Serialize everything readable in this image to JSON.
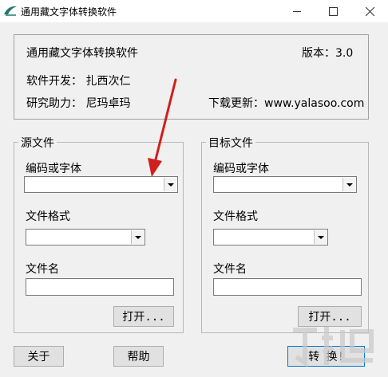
{
  "window": {
    "title": "通用藏文字体转换软件"
  },
  "info": {
    "app_name": "通用藏文字体转换软件",
    "version": "版本：3.0",
    "developer": "软件开发： 扎西次仁",
    "assistant": "研究助力： 尼玛卓玛",
    "download": "下载更新：www.yalasoo.com"
  },
  "source": {
    "group_label": "源文件",
    "encoding_label": "编码或字体",
    "encoding_value": "",
    "format_label": "文件格式",
    "format_value": "",
    "filename_label": "文件名",
    "filename_value": "",
    "open_button": "打开..."
  },
  "target": {
    "group_label": "目标文件",
    "encoding_label": "编码或字体",
    "encoding_value": "",
    "format_label": "文件格式",
    "format_value": "",
    "filename_label": "文件名",
    "filename_value": "",
    "open_button": "打开..."
  },
  "bottom": {
    "about_button": "关于",
    "help_button": "帮助",
    "convert_button": "转 换!"
  },
  "colors": {
    "annotation_arrow": "#d0201e",
    "app_icon": "#1f7a6b"
  }
}
